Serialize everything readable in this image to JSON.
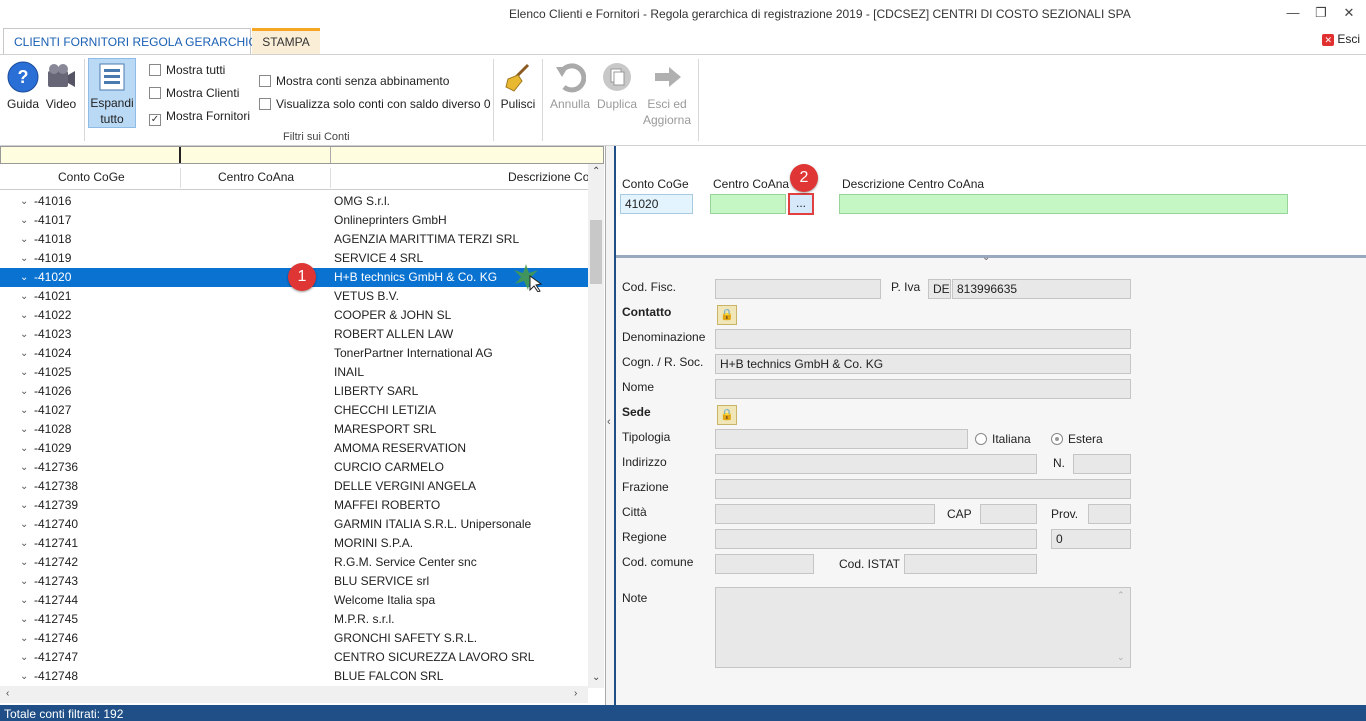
{
  "window": {
    "title": "Elenco Clienti e Fornitori - Regola gerarchica di registrazione 2019 - [CDCSEZ] CENTRI DI COSTO SEZIONALI SPA",
    "minimize": "—",
    "restore": "❐",
    "close": "✕"
  },
  "tabs": {
    "main": "CLIENTI FORNITORI REGOLA GERARCHICA",
    "stampa": "STAMPA",
    "esci": "Esci"
  },
  "ribbon": {
    "guida": "Guida",
    "video": "Video",
    "espandi_1": "Espandi",
    "espandi_2": "tutto",
    "mostra_tutti": "Mostra tutti",
    "mostra_clienti": "Mostra Clienti",
    "mostra_fornitori": "Mostra Fornitori",
    "mostra_fornitori_checked": "✓",
    "senza_abbinamento": "Mostra conti senza abbinamento",
    "saldo_diverso": "Visualizza solo conti con saldo diverso 0",
    "filtri_label": "Filtri sui Conti",
    "pulisci": "Pulisci",
    "annulla": "Annulla",
    "duplica": "Duplica",
    "esci_ed_1": "Esci ed",
    "esci_ed_2": "Aggiorna"
  },
  "grid": {
    "col_conto": "Conto CoGe",
    "col_centro": "Centro CoAna",
    "col_desc": "Descrizione Co",
    "rows": [
      {
        "code": "41016",
        "desc": "OMG S.r.l."
      },
      {
        "code": "41017",
        "desc": "Onlineprinters GmbH"
      },
      {
        "code": "41018",
        "desc": "AGENZIA MARITTIMA TERZI SRL"
      },
      {
        "code": "41019",
        "desc": "SERVICE 4 SRL"
      },
      {
        "code": "41020",
        "desc": "H+B technics GmbH & Co. KG"
      },
      {
        "code": "41021",
        "desc": "VETUS B.V."
      },
      {
        "code": "41022",
        "desc": "COOPER & JOHN SL"
      },
      {
        "code": "41023",
        "desc": "ROBERT ALLEN LAW"
      },
      {
        "code": "41024",
        "desc": "TonerPartner International AG"
      },
      {
        "code": "41025",
        "desc": "INAIL"
      },
      {
        "code": "41026",
        "desc": "LIBERTY SARL"
      },
      {
        "code": "41027",
        "desc": "CHECCHI LETIZIA"
      },
      {
        "code": "41028",
        "desc": "MARESPORT SRL"
      },
      {
        "code": "41029",
        "desc": "AMOMA RESERVATION"
      },
      {
        "code": "412736",
        "desc": "CURCIO CARMELO"
      },
      {
        "code": "412738",
        "desc": "DELLE VERGINI ANGELA"
      },
      {
        "code": "412739",
        "desc": "MAFFEI ROBERTO"
      },
      {
        "code": "412740",
        "desc": "GARMIN ITALIA S.R.L. Unipersonale"
      },
      {
        "code": "412741",
        "desc": "MORINI S.P.A."
      },
      {
        "code": "412742",
        "desc": "R.G.M. Service Center snc"
      },
      {
        "code": "412743",
        "desc": "BLU SERVICE srl"
      },
      {
        "code": "412744",
        "desc": "Welcome Italia spa"
      },
      {
        "code": "412745",
        "desc": "M.P.R. s.r.l."
      },
      {
        "code": "412746",
        "desc": "GRONCHI SAFETY S.R.L."
      },
      {
        "code": "412747",
        "desc": "CENTRO SICUREZZA LAVORO SRL"
      },
      {
        "code": "412748",
        "desc": "BLUE FALCON SRL"
      }
    ],
    "selected_index": 4,
    "badge_1": "1"
  },
  "detail_top": {
    "conto_label": "Conto CoGe",
    "conto_value": "41020",
    "centro_label": "Centro CoAna",
    "centro_value": "",
    "dots": "...",
    "desc_label": "Descrizione Centro CoAna",
    "desc_value": "",
    "badge_2": "2"
  },
  "detail": {
    "cod_fisc": "Cod. Fisc.",
    "cod_fisc_value": "",
    "p_iva": "P. Iva",
    "p_iva_prefix": "DE",
    "p_iva_value": "813996635",
    "contatto": "Contatto",
    "denominazione": "Denominazione",
    "denominazione_value": "",
    "cogn": "Cogn. / R. Soc.",
    "cogn_value": "H+B technics GmbH & Co. KG",
    "nome": "Nome",
    "nome_value": "",
    "sede": "Sede",
    "tipologia": "Tipologia",
    "tipologia_value": "",
    "italiana": "Italiana",
    "estera": "Estera",
    "indirizzo": "Indirizzo",
    "indirizzo_value": "",
    "n": "N.",
    "n_value": "",
    "frazione": "Frazione",
    "frazione_value": "",
    "citta": "Città",
    "citta_value": "",
    "cap": "CAP",
    "cap_value": "",
    "prov": "Prov.",
    "prov_value": "",
    "regione": "Regione",
    "regione_value": "",
    "regione_num": "0",
    "cod_comune": "Cod. comune",
    "cod_comune_value": "",
    "cod_istat": "Cod. ISTAT",
    "cod_istat_value": "",
    "note": "Note",
    "note_value": ""
  },
  "status": {
    "text": "Totale conti filtrati: 192"
  },
  "colors": {
    "selection": "#0a72d1",
    "status_bar": "#1f4f86",
    "green_field": "#c4f7c4",
    "badge": "#e03535",
    "stampa_tab": "#f5a623"
  }
}
